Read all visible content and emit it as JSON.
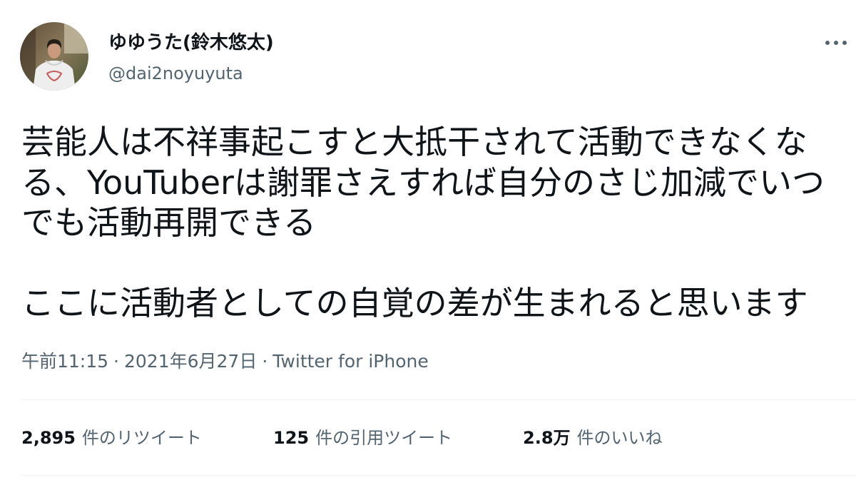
{
  "user": {
    "display_name": "ゆゆうた(鈴木悠太)",
    "handle": "@dai2noyuyuta"
  },
  "tweet": {
    "paragraphs": [
      [
        "芸能人は不祥事起こすと大抵干されて活動できなくな",
        "る、YouTuberは謝罪さえすれば自分のさじ加減でいつ",
        "でも活動再開できる"
      ],
      [
        "ここに活動者としての自覚の差が生まれると思います"
      ]
    ]
  },
  "meta": {
    "time": "午前11:15",
    "separator": "·",
    "date": "2021年6月27日",
    "source": "Twitter for iPhone"
  },
  "stats": [
    {
      "count": "2,895",
      "label": "件のリツイート"
    },
    {
      "count": "125",
      "label": "件の引用ツイート"
    },
    {
      "count": "2.8万",
      "label": "件のいいね"
    }
  ],
  "icons": {
    "avatar": "profile-photo",
    "more": "more-horizontal-icon"
  },
  "colors": {
    "text": "#0f1419",
    "secondary": "#536471",
    "divider": "#eff3f4",
    "background": "#ffffff"
  }
}
